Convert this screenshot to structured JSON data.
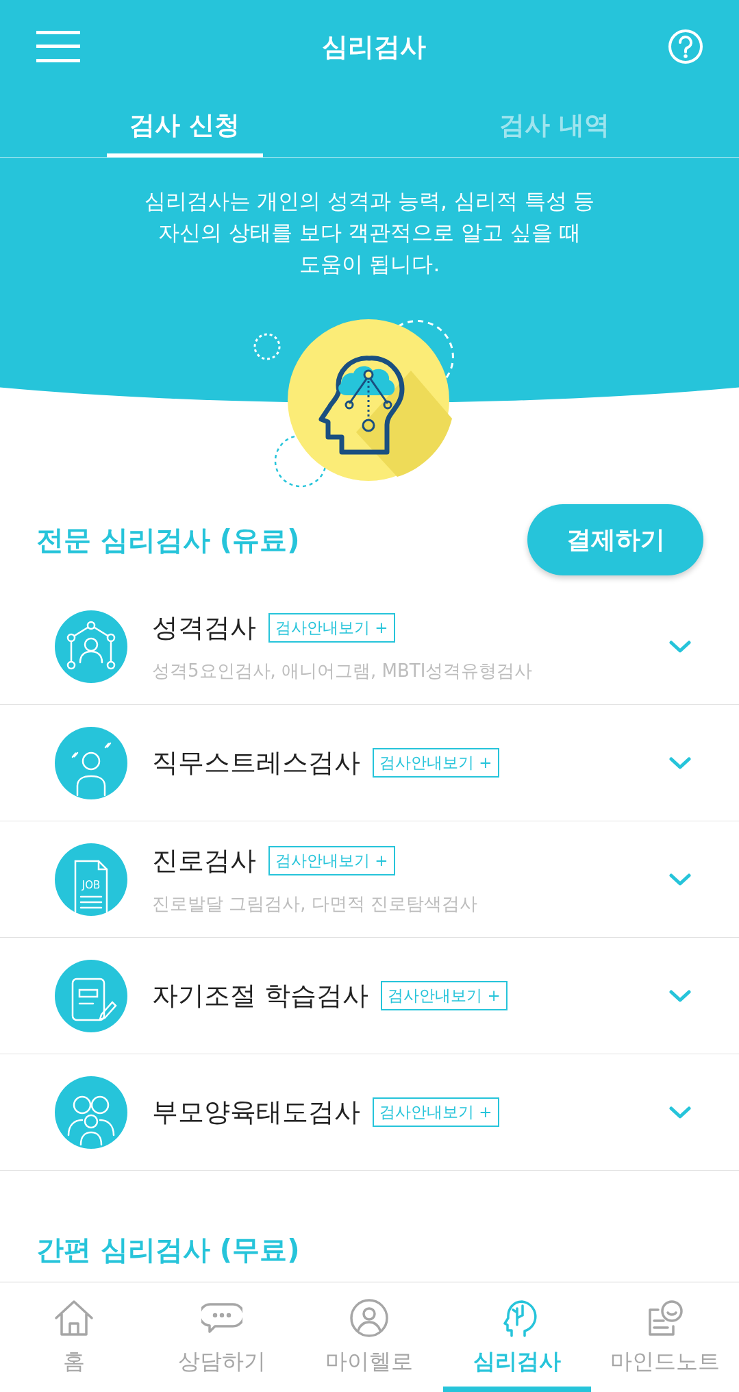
{
  "header": {
    "title": "심리검사"
  },
  "tabs": [
    {
      "label": "검사 신청",
      "selected": true
    },
    {
      "label": "검사 내역",
      "selected": false
    }
  ],
  "intro": "심리검사는 개인의 성격과 능력, 심리적 특성 등\n자신의 상태를 보다 객관적으로 알고 싶을 때\n도움이 됩니다.",
  "paid_section": {
    "title": "전문 심리검사 (유료)",
    "pay_button": "결제하기"
  },
  "tests": [
    {
      "title": "성격검사",
      "guide": "검사안내보기 +",
      "subtitle": "성격5요인검사, 애니어그램, MBTI성격유형검사",
      "expanded": false
    },
    {
      "title": "직무스트레스검사",
      "guide": "검사안내보기 +",
      "expanded": false
    },
    {
      "title": "진로검사",
      "guide": "검사안내보기 +",
      "subtitle": "진로발달 그림검사, 다면적 진로탐색검사",
      "icon_text": "JOB",
      "expanded": false
    },
    {
      "title": "자기조절 학습검사",
      "guide": "검사안내보기 +",
      "expanded": false
    },
    {
      "title": "부모양육태도검사",
      "guide": "검사안내보기 +",
      "expanded": false
    }
  ],
  "free_section": {
    "title": "간편 심리검사 (무료)"
  },
  "bottom_nav": [
    {
      "label": "홈",
      "selected": false
    },
    {
      "label": "상담하기",
      "selected": false
    },
    {
      "label": "마이헬로",
      "selected": false
    },
    {
      "label": "심리검사",
      "selected": true
    },
    {
      "label": "마인드노트",
      "selected": false
    }
  ]
}
